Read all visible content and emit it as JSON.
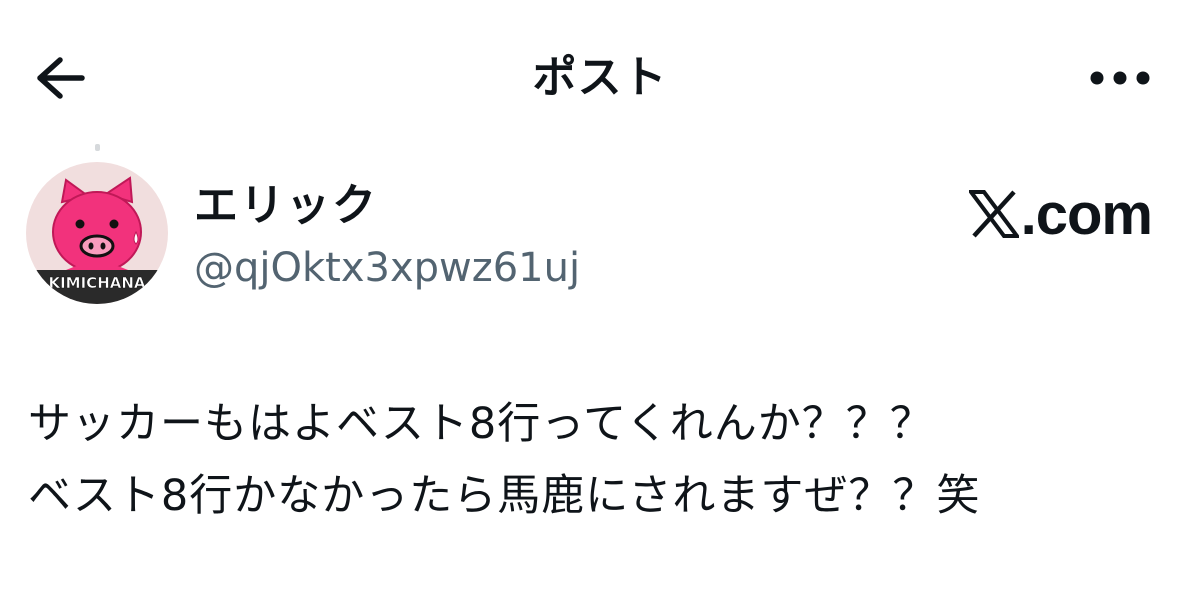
{
  "header": {
    "title": "ポスト",
    "back_icon": "arrow-left-icon",
    "more_icon": "more-horizontal-icon"
  },
  "author": {
    "display_name": "エリック",
    "handle": "@qjOktx3xpwz61uj",
    "avatar": {
      "label": "KIMICHANA",
      "background": "#f1dede",
      "character_color": "#f2327c"
    }
  },
  "watermark": {
    "logo_text": ".com"
  },
  "tweet": {
    "lines": [
      "サッカーもはよベスト8行ってくれんか？？？",
      "ベスト8行かなかったら馬鹿にされますぜ？？笑"
    ]
  },
  "colors": {
    "text": "#0f1419",
    "secondary_text": "#536471",
    "background": "#ffffff"
  }
}
